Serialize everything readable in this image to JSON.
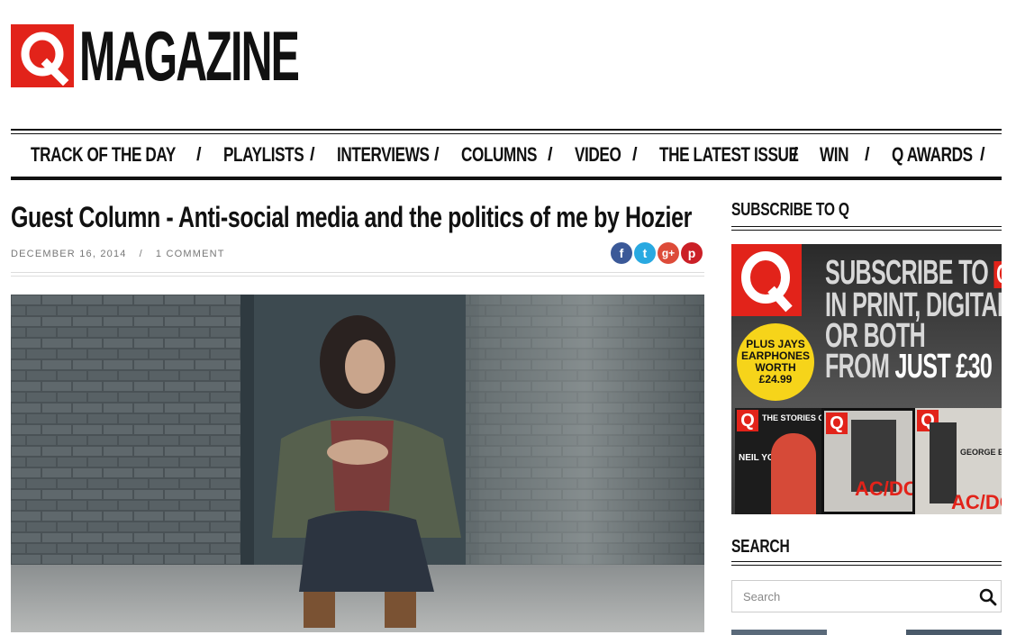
{
  "brand": {
    "logo_letter": "Q",
    "logo_word": "MAGAZINE",
    "accent": "#e2231a"
  },
  "nav": {
    "items": [
      {
        "label": "TRACK OF THE DAY"
      },
      {
        "label": "PLAYLISTS"
      },
      {
        "label": "INTERVIEWS"
      },
      {
        "label": "COLUMNS"
      },
      {
        "label": "VIDEO"
      },
      {
        "label": "THE LATEST ISSUE"
      },
      {
        "label": "WIN"
      },
      {
        "label": "Q AWARDS"
      }
    ],
    "separator": "/"
  },
  "article": {
    "title": "Guest Column - Anti-social media and the politics of me by Hozier",
    "date": "DECEMBER 16, 2014",
    "meta_sep": "/",
    "comments": "1 COMMENT",
    "share": [
      {
        "icon": "facebook-icon",
        "glyph": "f",
        "color": "#3b5998"
      },
      {
        "icon": "twitter-icon",
        "glyph": "t",
        "color": "#29a9e1"
      },
      {
        "icon": "google-plus-icon",
        "glyph": "g+",
        "color": "#dd4b39"
      },
      {
        "icon": "pinterest-icon",
        "glyph": "p",
        "color": "#cb2027"
      }
    ]
  },
  "sidebar": {
    "subscribe_heading": "SUBSCRIBE TO Q",
    "promo": {
      "line1": "SUBSCRIBE TO",
      "line1_q": "Q",
      "line2": "IN PRINT, DIGITAL",
      "line3": "OR BOTH",
      "line4_a": "FROM",
      "line4_b": "JUST £30",
      "badge": [
        "PLUS JAYS",
        "EARPHONES",
        "WORTH",
        "£24.99"
      ],
      "cover1_text": "THE STORIES OF",
      "cover1_name": "NEIL YOUNG",
      "cover2_text": "AC/DC",
      "cover3_text": "AC/DC",
      "cover3_sub": "GEORGE EZRA"
    },
    "search_heading": "SEARCH",
    "search_placeholder": "Search"
  }
}
